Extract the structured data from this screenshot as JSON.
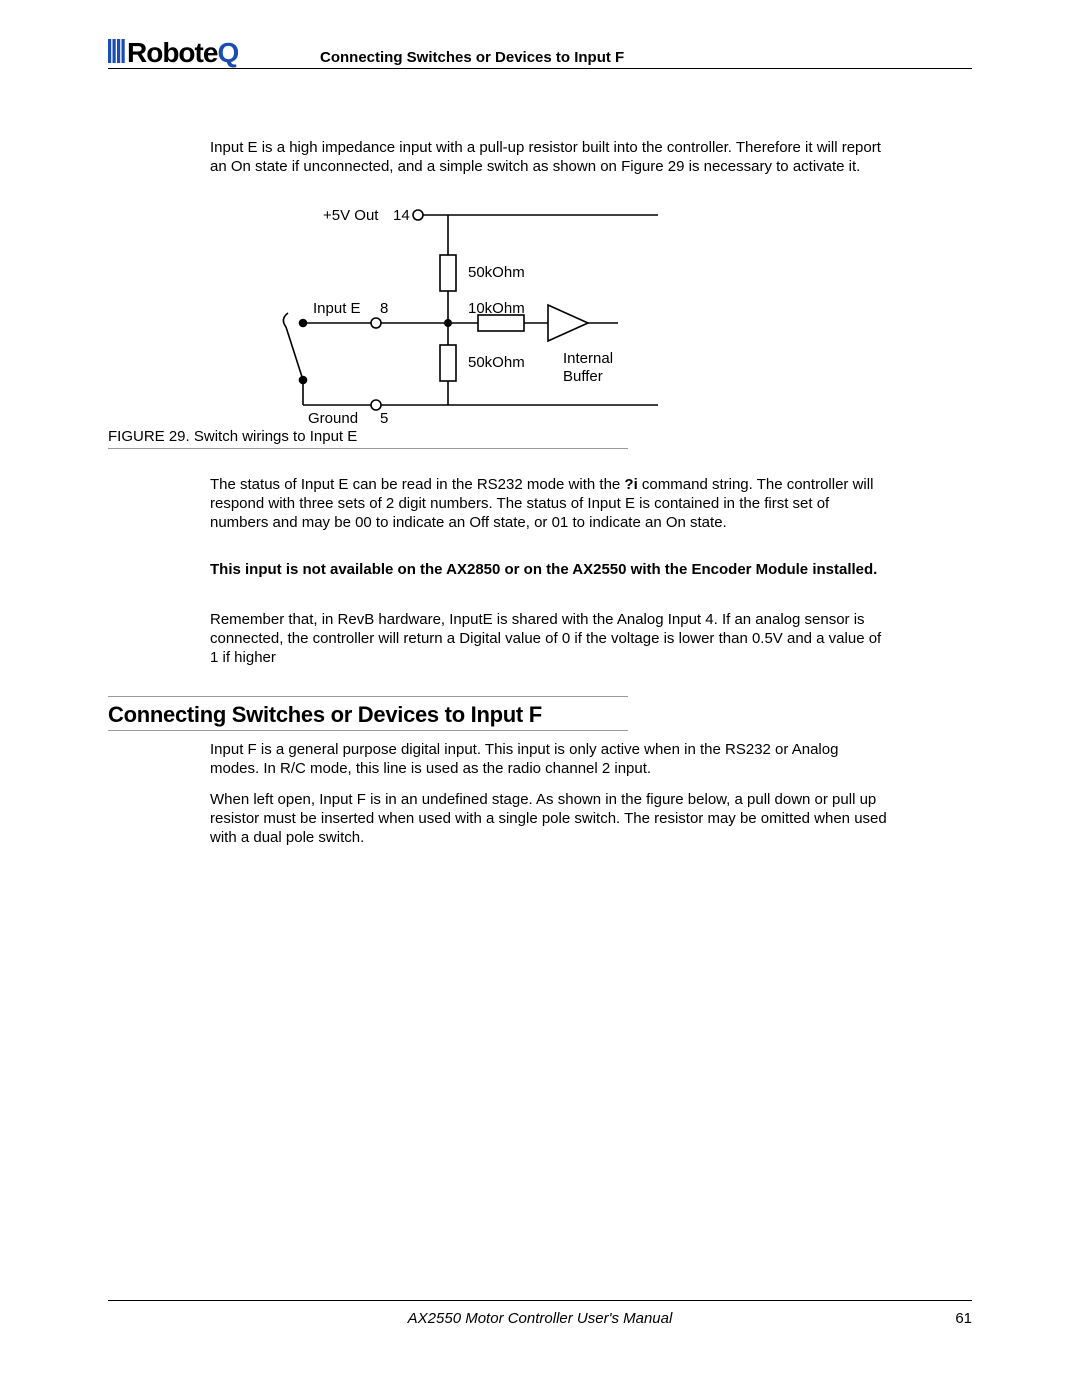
{
  "logo_text": "Roboteq",
  "header": {
    "title": "Connecting Switches or Devices to Input F"
  },
  "paragraphs": {
    "p1": "Input E is a high impedance input with a pull-up resistor built into the controller. Therefore it will report an On state if unconnected, and a simple switch as shown on Figure 29 is necessary to activate it.",
    "p2a": "The status of Input E can be read in the RS232 mode with the ",
    "p2b": "?i",
    "p2c": " command string. The controller will respond with three sets of 2 digit numbers. The status of Input E is contained in the first set of numbers and may be 00 to indicate an Off state, or 01 to indicate an On state.",
    "p3": "This input is not available on the AX2850 or on the AX2550 with the Encoder Module installed.",
    "p4": "Remember that, in RevB hardware, InputE is shared with the Analog Input 4. If an analog sensor is connected, the controller will return a Digital value of 0 if the voltage is lower than 0.5V and a value of 1 if higher",
    "p5": "Input F is a general purpose digital input. This input is only active when in the RS232 or Analog modes. In R/C mode, this line is used as the radio channel 2 input.",
    "p6": "When left open, Input F is in an undefined stage. As shown in the figure below, a pull down or pull up resistor must be inserted when used with a single pole switch. The resistor may be omitted when used with a dual pole switch."
  },
  "figure": {
    "caption": "FIGURE 29.  Switch wirings to Input E",
    "labels": {
      "vout": "+5V Out",
      "vout_pin": "14",
      "inputE": "Input E",
      "inputE_pin": "8",
      "ground": "Ground",
      "ground_pin": "5",
      "r_top": "50kOhm",
      "r_inline": "10kOhm",
      "r_bot": "50kOhm",
      "buf1": "Internal",
      "buf2": "Buffer"
    }
  },
  "section_heading": "Connecting Switches or Devices to Input F",
  "footer": {
    "center": "AX2550 Motor Controller User's Manual",
    "page": "61"
  }
}
